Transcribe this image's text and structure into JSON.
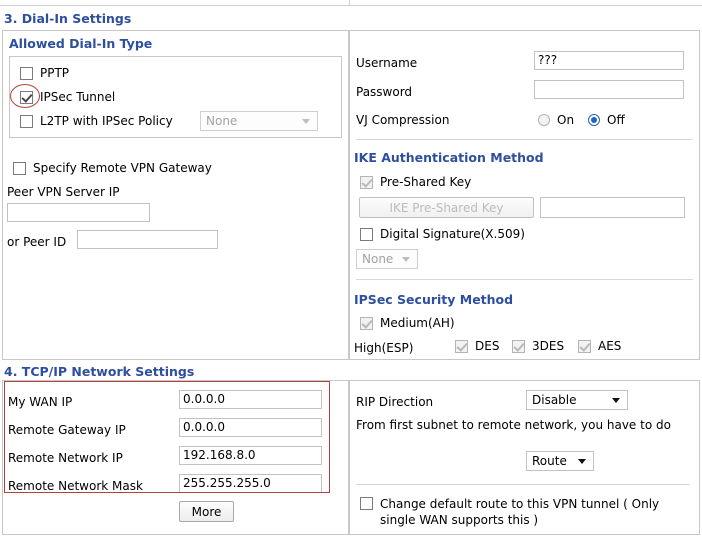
{
  "sections": {
    "dial_in": {
      "heading": "3. Dial-In Settings",
      "allowed_type": {
        "heading": "Allowed Dial-In Type",
        "items": [
          {
            "label": "PPTP",
            "checked": false,
            "disabled": false
          },
          {
            "label": "IPSec Tunnel",
            "checked": true,
            "disabled": false
          },
          {
            "label": "L2TP with IPSec Policy",
            "checked": false,
            "disabled": false
          }
        ],
        "policy_select": {
          "value": "None",
          "disabled": true
        }
      },
      "remote_gateway": {
        "specify_label": "Specify Remote VPN Gateway",
        "specify_checked": false,
        "peer_ip_label": "Peer VPN Server IP",
        "peer_ip_value": "",
        "peer_id_label": "or Peer ID",
        "peer_id_value": ""
      },
      "credentials": {
        "username_label": "Username",
        "username_value": "???",
        "password_label": "Password",
        "password_value": "",
        "vj_label": "VJ Compression",
        "vj_on_label": "On",
        "vj_off_label": "Off",
        "vj_selected": "Off"
      },
      "ike_auth": {
        "heading": "IKE Authentication Method",
        "preshared_label": "Pre-Shared Key",
        "preshared_checked": true,
        "preshared_disabled": true,
        "psk_button_label": "IKE Pre-Shared Key",
        "psk_button_disabled": true,
        "psk_value": "",
        "digital_sig_label": "Digital Signature(X.509)",
        "digital_sig_checked": false,
        "cert_select": {
          "value": "None",
          "disabled": true
        }
      },
      "ipsec_security": {
        "heading": "IPSec Security Method",
        "medium_label": "Medium(AH)",
        "medium_checked": true,
        "medium_disabled": true,
        "high_label": "High(ESP)",
        "ciphers": [
          {
            "label": "DES",
            "checked": true,
            "disabled": true
          },
          {
            "label": "3DES",
            "checked": true,
            "disabled": true
          },
          {
            "label": "AES",
            "checked": true,
            "disabled": true
          }
        ]
      }
    },
    "tcpip": {
      "heading": "4. TCP/IP Network Settings",
      "fields": [
        {
          "label": "My WAN IP",
          "value": "0.0.0.0"
        },
        {
          "label": "Remote Gateway IP",
          "value": "0.0.0.0"
        },
        {
          "label": "Remote Network IP",
          "value": "192.168.8.0"
        },
        {
          "label": "Remote Network Mask",
          "value": "255.255.255.0"
        }
      ],
      "more_button_label": "More",
      "rip_label": "RIP Direction",
      "rip_select": {
        "value": "Disable",
        "disabled": false
      },
      "subnet_note": "From first subnet to remote network, you have to do",
      "route_select": {
        "value": "Route",
        "disabled": false
      },
      "change_route_label": "Change default route to this VPN tunnel ( Only single WAN supports this )",
      "change_route_checked": false
    }
  },
  "annotations": {
    "accent_color": "#b0443c",
    "heading_color": "#2d4f9e"
  }
}
